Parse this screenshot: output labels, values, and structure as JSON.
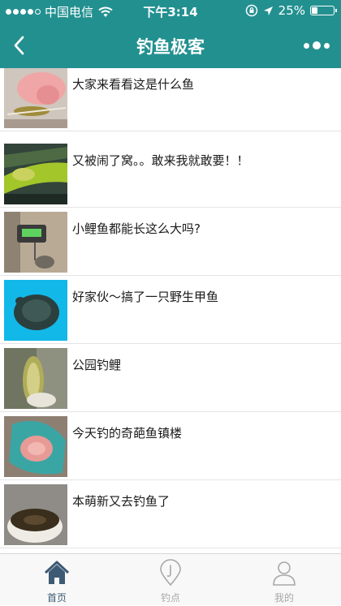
{
  "status": {
    "carrier": "中国电信",
    "time": "下午3:14",
    "battery": "25%",
    "battery_level": 0.25
  },
  "navbar": {
    "title": "钓鱼极客"
  },
  "posts": [
    {
      "title": "大家来看看这是什么鱼"
    },
    {
      "title": "又被闹了窝。。敢来我就敢要！！"
    },
    {
      "title": "小鲤鱼都能长这么大吗?"
    },
    {
      "title": "好家伙～搞了一只野生甲鱼"
    },
    {
      "title": "公园钓鲤"
    },
    {
      "title": "今天钓的奇葩鱼镇楼"
    },
    {
      "title": "本萌新又去钓鱼了"
    }
  ],
  "tabs": [
    {
      "label": "首页",
      "icon": "home-icon",
      "active": true
    },
    {
      "label": "钓点",
      "icon": "location-pin-icon",
      "active": false
    },
    {
      "label": "我的",
      "icon": "user-icon",
      "active": false
    }
  ],
  "colors": {
    "accent": "#239090",
    "tab_active": "#3d5a75",
    "tab_inactive": "#a8a8a8"
  }
}
